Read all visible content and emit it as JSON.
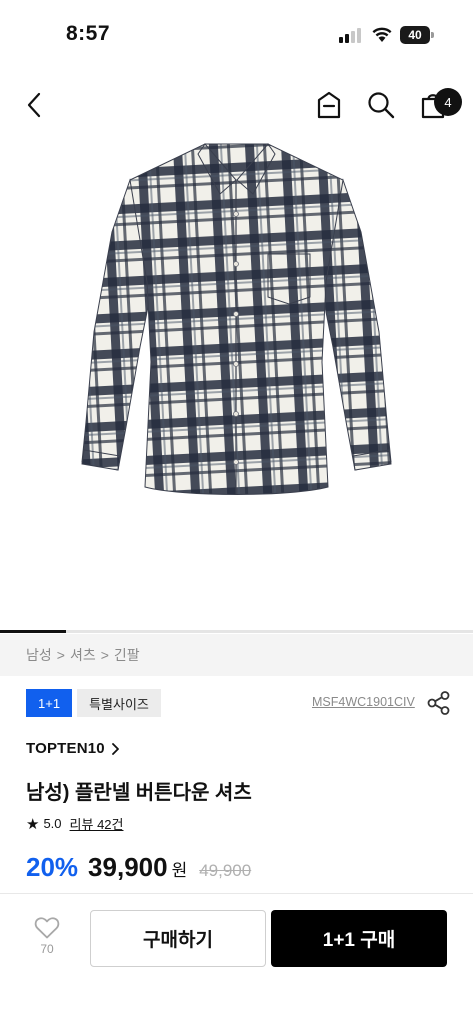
{
  "status_bar": {
    "time": "8:57",
    "battery": "40"
  },
  "nav": {
    "cart_count": "4",
    "icons": [
      "chevron-left-icon",
      "menu-icon",
      "search-icon",
      "shopping-bag-icon"
    ]
  },
  "image": {
    "carousel_progress": 0.14
  },
  "breadcrumb": {
    "items": [
      "남성",
      "셔츠",
      "긴팔"
    ],
    "separator": ">"
  },
  "tags": {
    "bundle": "1+1",
    "size": "특별사이즈"
  },
  "product": {
    "code": "MSF4WC1901CIV",
    "brand": "TOPTEN10",
    "name": "남성) 플란넬 버튼다운 셔츠",
    "rating": "5.0",
    "review_label": "리뷰 42건",
    "discount": "20%",
    "price": "39,900",
    "currency": "원",
    "original_price": "49,900"
  },
  "bottom_bar": {
    "wish_count": "70",
    "buy_label": "구매하기",
    "bundle_buy_label": "1+1 구매"
  },
  "colors": {
    "accent": "#1160ee",
    "black": "#000000",
    "muted": "#8a8a8a"
  }
}
